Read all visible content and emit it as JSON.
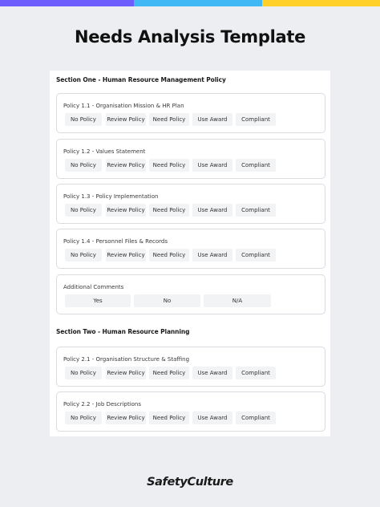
{
  "topbar_colors": [
    "#6d5dfc",
    "#3fb8f5",
    "#ffd029"
  ],
  "title": "Needs Analysis Template",
  "sections": [
    {
      "title": "Section One - Human Resource Management Policy",
      "cards": [
        {
          "label": "Policy 1.1 - Organisation Mission & HR Plan",
          "options": [
            "No Policy",
            "Review Policy",
            "Need Policy",
            "Use Award",
            "Compliant"
          ]
        },
        {
          "label": "Policy 1.2 - Values Statement",
          "options": [
            "No Policy",
            "Review Policy",
            "Need Policy",
            "Use Award",
            "Compliant"
          ]
        },
        {
          "label": "Policy 1.3 - Policy Implementation",
          "options": [
            "No Policy",
            "Review Policy",
            "Need Policy",
            "Use Award",
            "Compliant"
          ]
        },
        {
          "label": "Policy 1.4 - Personnel Files & Records",
          "options": [
            "No Policy",
            "Review Policy",
            "Need Policy",
            "Use Award",
            "Compliant"
          ]
        },
        {
          "label": "Additional Comments",
          "options": [
            "Yes",
            "No",
            "N/A"
          ]
        }
      ]
    },
    {
      "title": "Section Two - Human Resource Planning",
      "cards": [
        {
          "label": "Policy 2.1 - Organisation Structure & Staffing",
          "options": [
            "No Policy",
            "Review Policy",
            "Need Policy",
            "Use Award",
            "Compliant"
          ]
        },
        {
          "label": "Policy 2.2 - Job Descriptions",
          "options": [
            "No Policy",
            "Review Policy",
            "Need Policy",
            "Use Award",
            "Compliant"
          ]
        }
      ]
    }
  ],
  "footer": {
    "brand": "SafetyCulture"
  }
}
